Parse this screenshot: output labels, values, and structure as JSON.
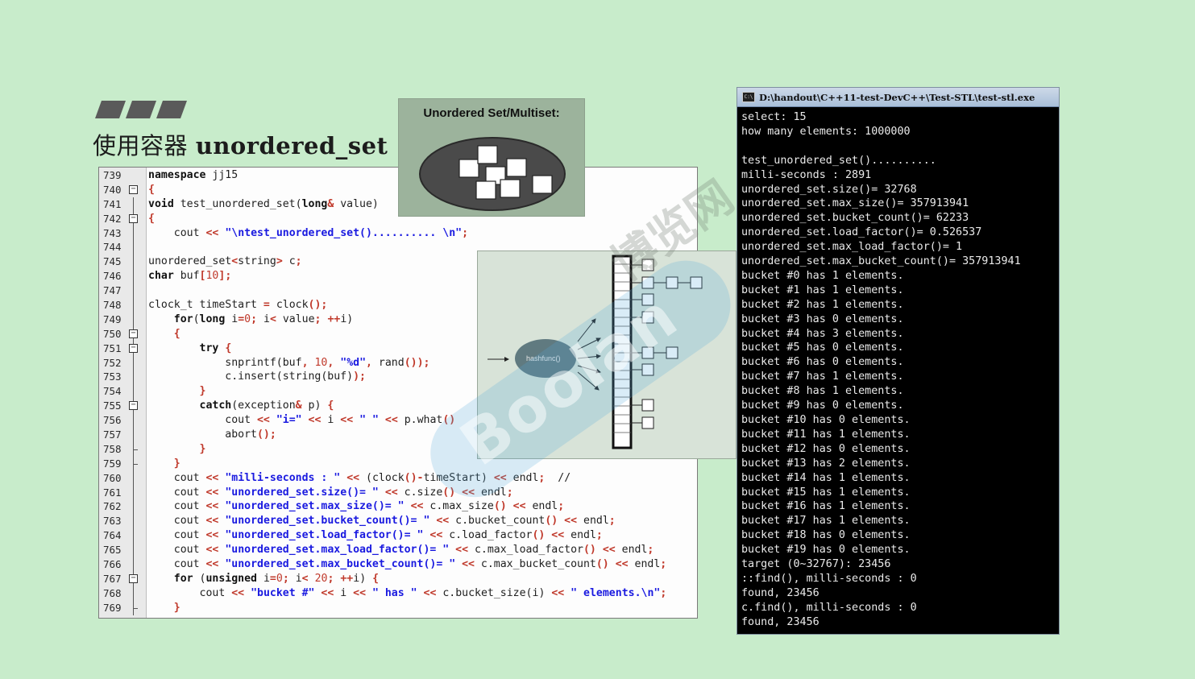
{
  "slide": {
    "title_cn": "使用容器",
    "title_en": "unordered_set"
  },
  "set_diagram": {
    "title": "Unordered Set/Multiset:"
  },
  "hash_diagram": {
    "func_label": "hashfunc()"
  },
  "code": {
    "line_numbers": [
      "739",
      "740",
      "741",
      "742",
      "743",
      "744",
      "745",
      "746",
      "747",
      "748",
      "749",
      "750",
      "751",
      "752",
      "753",
      "754",
      "755",
      "756",
      "757",
      "758",
      "759",
      "760",
      "761",
      "762",
      "763",
      "764",
      "765",
      "766",
      "767",
      "768",
      "769"
    ]
  },
  "console": {
    "title": "D:\\handout\\C++11-test-DevC++\\Test-STL\\test-stl.exe",
    "icon": "C:\\",
    "lines": [
      "select: 15",
      "how many elements: 1000000",
      "",
      "test_unordered_set()..........",
      "milli-seconds : 2891",
      "unordered_set.size()= 32768",
      "unordered_set.max_size()= 357913941",
      "unordered_set.bucket_count()= 62233",
      "unordered_set.load_factor()= 0.526537",
      "unordered_set.max_load_factor()= 1",
      "unordered_set.max_bucket_count()= 357913941",
      "bucket #0 has 1 elements.",
      "bucket #1 has 1 elements.",
      "bucket #2 has 1 elements.",
      "bucket #3 has 0 elements.",
      "bucket #4 has 3 elements.",
      "bucket #5 has 0 elements.",
      "bucket #6 has 0 elements.",
      "bucket #7 has 1 elements.",
      "bucket #8 has 1 elements.",
      "bucket #9 has 0 elements.",
      "bucket #10 has 0 elements.",
      "bucket #11 has 1 elements.",
      "bucket #12 has 0 elements.",
      "bucket #13 has 2 elements.",
      "bucket #14 has 1 elements.",
      "bucket #15 has 1 elements.",
      "bucket #16 has 1 elements.",
      "bucket #17 has 1 elements.",
      "bucket #18 has 0 elements.",
      "bucket #19 has 0 elements.",
      "target (0~32767): 23456",
      "::find(), milli-seconds : 0",
      "found, 23456",
      "c.find(), milli-seconds : 0",
      "found, 23456"
    ]
  },
  "watermark": {
    "text": "Boolan",
    "cn": "博览网"
  },
  "colors": {
    "background": "#c8eccb",
    "string": "#1a1ae0",
    "punct": "#c0392b",
    "console_bg": "#000000"
  }
}
